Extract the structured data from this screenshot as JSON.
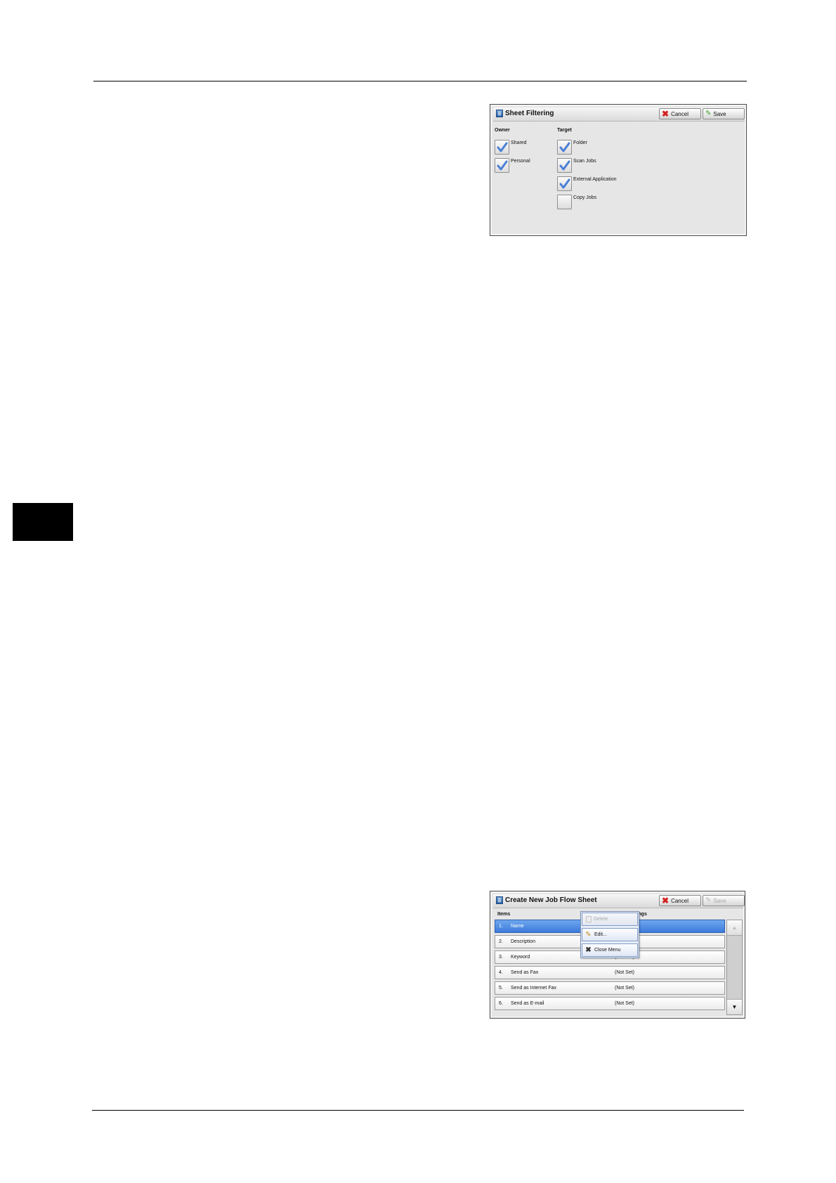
{
  "sheet_filtering": {
    "title": "Sheet Filtering",
    "cancel_label": "Cancel",
    "save_label": "Save",
    "owner_label": "Owner",
    "target_label": "Target",
    "owner_options": [
      {
        "label": "Shared",
        "checked": true
      },
      {
        "label": "Personal",
        "checked": true
      }
    ],
    "target_options": [
      {
        "label": "Folder",
        "checked": true
      },
      {
        "label": "Scan Jobs",
        "checked": true
      },
      {
        "label": "External Application",
        "checked": true
      },
      {
        "label": "Copy Jobs",
        "checked": false
      }
    ]
  },
  "job_flow": {
    "title": "Create New Job Flow Sheet",
    "cancel_label": "Cancel",
    "save_label": "Save",
    "col_items": "Items",
    "col_settings": "Current Settings",
    "rows": [
      {
        "num": "1.",
        "item": "Name",
        "value": ""
      },
      {
        "num": "2.",
        "item": "Description",
        "value": ""
      },
      {
        "num": "3.",
        "item": "Keyword",
        "value": "(Not Set)"
      },
      {
        "num": "4.",
        "item": "Send as Fax",
        "value": "(Not Set)"
      },
      {
        "num": "5.",
        "item": "Send as Internet Fax",
        "value": "(Not Set)"
      },
      {
        "num": "6.",
        "item": "Send as E-mail",
        "value": "(Not Set)"
      }
    ],
    "popup": {
      "delete_label": "Delete",
      "edit_label": "Edit...",
      "close_label": "Close Menu"
    },
    "scroll_up": "▲",
    "scroll_down": "▼"
  },
  "colors": {
    "selected_row": "#3b7bdc",
    "check": "#4a7fd6",
    "cancel_icon": "#d42020",
    "save_icon": "#3c9a2a"
  }
}
